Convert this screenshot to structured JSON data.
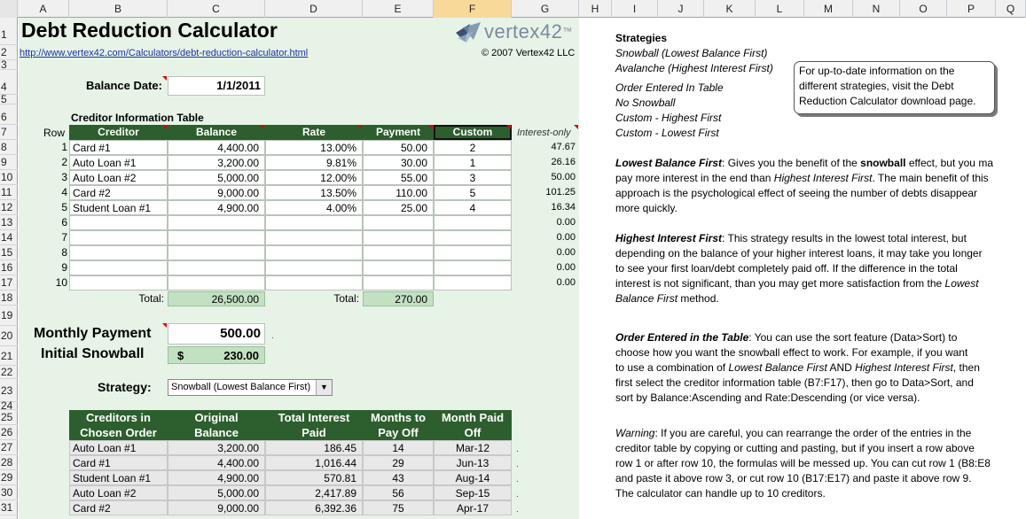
{
  "column_headers": [
    "A",
    "B",
    "C",
    "D",
    "E",
    "F",
    "G",
    "H",
    "I",
    "J",
    "K",
    "L",
    "M",
    "N",
    "O",
    "P",
    "Q"
  ],
  "row_headers": [
    "1",
    "2",
    "3",
    "4",
    "5",
    "6",
    "7",
    "8",
    "9",
    "10",
    "11",
    "12",
    "13",
    "14",
    "15",
    "16",
    "17",
    "18",
    "19",
    "20",
    "21",
    "22",
    "23",
    "24",
    "25",
    "26",
    "27",
    "28",
    "29",
    "30",
    "31"
  ],
  "title": "Debt Reduction Calculator",
  "url": "http://www.vertex42.com/Calculators/debt-reduction-calculator.html",
  "copyright": "© 2007 Vertex42 LLC",
  "logo": {
    "text": "vertex",
    "sup": "42",
    "tm": "™"
  },
  "balance_date": {
    "label": "Balance Date:",
    "value": "1/1/2011"
  },
  "creditor_table": {
    "caption": "Creditor Information Table",
    "row_label": "Row",
    "headers": [
      "Creditor",
      "Balance",
      "Rate",
      "Payment",
      "Custom"
    ],
    "interest_header": "Interest-only",
    "rows": [
      {
        "n": "1",
        "creditor": "Card #1",
        "balance": "4,400.00",
        "rate": "13.00%",
        "payment": "50.00",
        "custom": "2",
        "interest": "47.67"
      },
      {
        "n": "2",
        "creditor": "Auto Loan #1",
        "balance": "3,200.00",
        "rate": "9.81%",
        "payment": "30.00",
        "custom": "1",
        "interest": "26.16"
      },
      {
        "n": "3",
        "creditor": "Auto Loan #2",
        "balance": "5,000.00",
        "rate": "12.00%",
        "payment": "55.00",
        "custom": "3",
        "interest": "50.00"
      },
      {
        "n": "4",
        "creditor": "Card #2",
        "balance": "9,000.00",
        "rate": "13.50%",
        "payment": "110.00",
        "custom": "5",
        "interest": "101.25"
      },
      {
        "n": "5",
        "creditor": "Student Loan #1",
        "balance": "4,900.00",
        "rate": "4.00%",
        "payment": "25.00",
        "custom": "4",
        "interest": "16.34"
      },
      {
        "n": "6",
        "creditor": "",
        "balance": "",
        "rate": "",
        "payment": "",
        "custom": "",
        "interest": "0.00"
      },
      {
        "n": "7",
        "creditor": "",
        "balance": "",
        "rate": "",
        "payment": "",
        "custom": "",
        "interest": "0.00"
      },
      {
        "n": "8",
        "creditor": "",
        "balance": "",
        "rate": "",
        "payment": "",
        "custom": "",
        "interest": "0.00"
      },
      {
        "n": "9",
        "creditor": "",
        "balance": "",
        "rate": "",
        "payment": "",
        "custom": "",
        "interest": "0.00"
      },
      {
        "n": "10",
        "creditor": "",
        "balance": "",
        "rate": "",
        "payment": "",
        "custom": "",
        "interest": "0.00"
      }
    ],
    "total_label": "Total:",
    "total_balance": "26,500.00",
    "total_payment": "270.00"
  },
  "monthly_payment": {
    "label": "Monthly Payment",
    "value": "500.00"
  },
  "initial_snowball": {
    "label": "Initial Snowball",
    "currency": "$",
    "value": "230.00"
  },
  "strategy": {
    "label": "Strategy:",
    "selected": "Snowball (Lowest Balance First)"
  },
  "results_table": {
    "headers": [
      [
        "Creditors in",
        "Chosen Order"
      ],
      [
        "Original",
        "Balance"
      ],
      [
        "Total Interest",
        "Paid"
      ],
      [
        "Months to",
        "Pay Off"
      ],
      [
        "Month Paid",
        "Off"
      ]
    ],
    "rows": [
      {
        "creditor": "Auto Loan #1",
        "balance": "3,200.00",
        "interest": "186.45",
        "months": "14",
        "paid_off": "Mar-12"
      },
      {
        "creditor": "Card #1",
        "balance": "4,400.00",
        "interest": "1,016.44",
        "months": "29",
        "paid_off": "Jun-13"
      },
      {
        "creditor": "Student Loan #1",
        "balance": "4,900.00",
        "interest": "570.81",
        "months": "43",
        "paid_off": "Aug-14"
      },
      {
        "creditor": "Auto Loan #2",
        "balance": "5,000.00",
        "interest": "2,417.89",
        "months": "56",
        "paid_off": "Sep-15"
      },
      {
        "creditor": "Card #2",
        "balance": "9,000.00",
        "interest": "6,392.36",
        "months": "75",
        "paid_off": "Apr-17"
      }
    ]
  },
  "strategies_panel": {
    "heading": "Strategies",
    "items": [
      "Snowball (Lowest Balance First)",
      "Avalanche (Highest Interest First)",
      "Order Entered In Table",
      "No Snowball",
      "Custom - Highest First",
      "Custom - Lowest First"
    ],
    "callout": "For up-to-date information on the different strategies, visit the Debt Reduction Calculator download page.",
    "lowest": {
      "title": "Lowest Balance First",
      "l1a": ": Gives you the benefit of the ",
      "l1b": "snowball",
      "l1c": " effect, but you ma",
      "l2a": "pay more interest in the end than ",
      "l2b": "Highest Interest First",
      "l2c": ". The main benefit of this",
      "l3": "approach is the psychological effect of seeing the number of debts disappear",
      "l4": "more quickly."
    },
    "highest": {
      "title": "Highest Interest First",
      "l1": ": This strategy results in the lowest total interest, but",
      "l2": "depending on the balance of your higher interest loans, it may take you longer",
      "l3": "to see your first loan/debt completely paid off. If the difference in the total",
      "l4a": "interest is not significant, than you may get more satisfaction from the ",
      "l4b": "Lowest",
      "l5a": "Balance First",
      "l5b": " method."
    },
    "order": {
      "title": "Order Entered in the Table",
      "l1": ": You can use the sort feature (Data>Sort) to",
      "l2": "choose how you want the snowball effect to work. For example, if you want",
      "l3a": "to use a combination of ",
      "l3b": "Lowest Balance First",
      "l3c": " AND ",
      "l3d": "Highest Interest First",
      "l3e": ", then",
      "l4": "first select the creditor information table (B7:F17), then go to Data>Sort, and",
      "l5": "sort by Balance:Ascending and Rate:Descending (or vice versa)."
    },
    "warning": {
      "title": "Warning",
      "l1": ": If you are careful, you can rearrange the order of the entries in the",
      "l2": "creditor table by copying or cutting and pasting, but if you insert a row above",
      "l3": "row 1 or after row 10, the formulas will be messed up. You can cut row 1 (B8:E8",
      "l4": "and paste it above row 3, or cut row 10 (B17:E17) and paste it above row 9.",
      "l5": "The calculator can handle up to 10 creditors."
    }
  }
}
